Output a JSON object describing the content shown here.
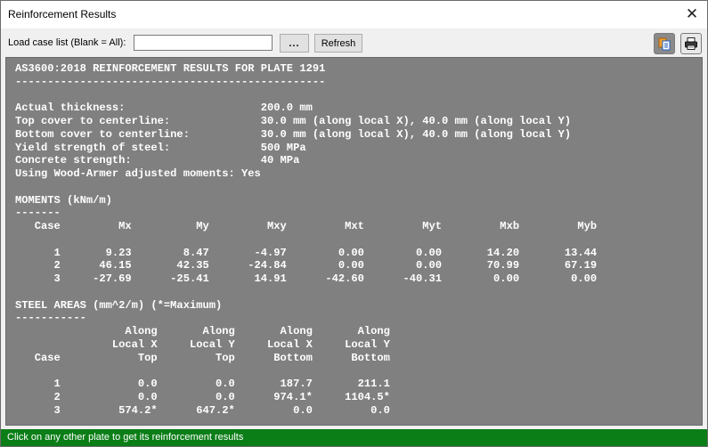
{
  "window": {
    "title": "Reinforcement Results"
  },
  "toolbar": {
    "load_case_label": "Load case list (Blank = All):",
    "load_case_value": "",
    "browse_label": "...",
    "refresh_label": "Refresh"
  },
  "icons": {
    "copy": "copy-icon",
    "print": "printer-icon",
    "close": "close-icon"
  },
  "colors": {
    "report_bg": "#808080",
    "status_bg": "#0b7e17"
  },
  "report": {
    "lines": [
      "AS3600:2018 REINFORCEMENT RESULTS FOR PLATE 1291",
      "------------------------------------------------",
      "",
      "Actual thickness:                     200.0 mm",
      "Top cover to centerline:              30.0 mm (along local X), 40.0 mm (along local Y)",
      "Bottom cover to centerline:           30.0 mm (along local X), 40.0 mm (along local Y)",
      "Yield strength of steel:              500 MPa",
      "Concrete strength:                    40 MPa",
      "Using Wood-Armer adjusted moments: Yes",
      "",
      "MOMENTS (kNm/m)",
      "-------",
      "   Case         Mx          My         Mxy         Mxt         Myt         Mxb         Myb",
      "",
      "      1       9.23        8.47       -4.97        0.00        0.00       14.20       13.44",
      "      2      46.15       42.35      -24.84        0.00        0.00       70.99       67.19",
      "      3     -27.69      -25.41       14.91      -42.60      -40.31        0.00        0.00",
      "",
      "STEEL AREAS (mm^2/m) (*=Maximum)",
      "-----------",
      "                 Along       Along       Along       Along",
      "               Local X     Local Y     Local X     Local Y",
      "   Case            Top         Top      Bottom      Bottom",
      "",
      "      1            0.0         0.0       187.7       211.1",
      "      2            0.0         0.0      974.1*     1104.5*",
      "      3         574.2*      647.2*         0.0         0.0"
    ]
  },
  "status": {
    "text": "Click on any other plate to get its reinforcement results"
  }
}
